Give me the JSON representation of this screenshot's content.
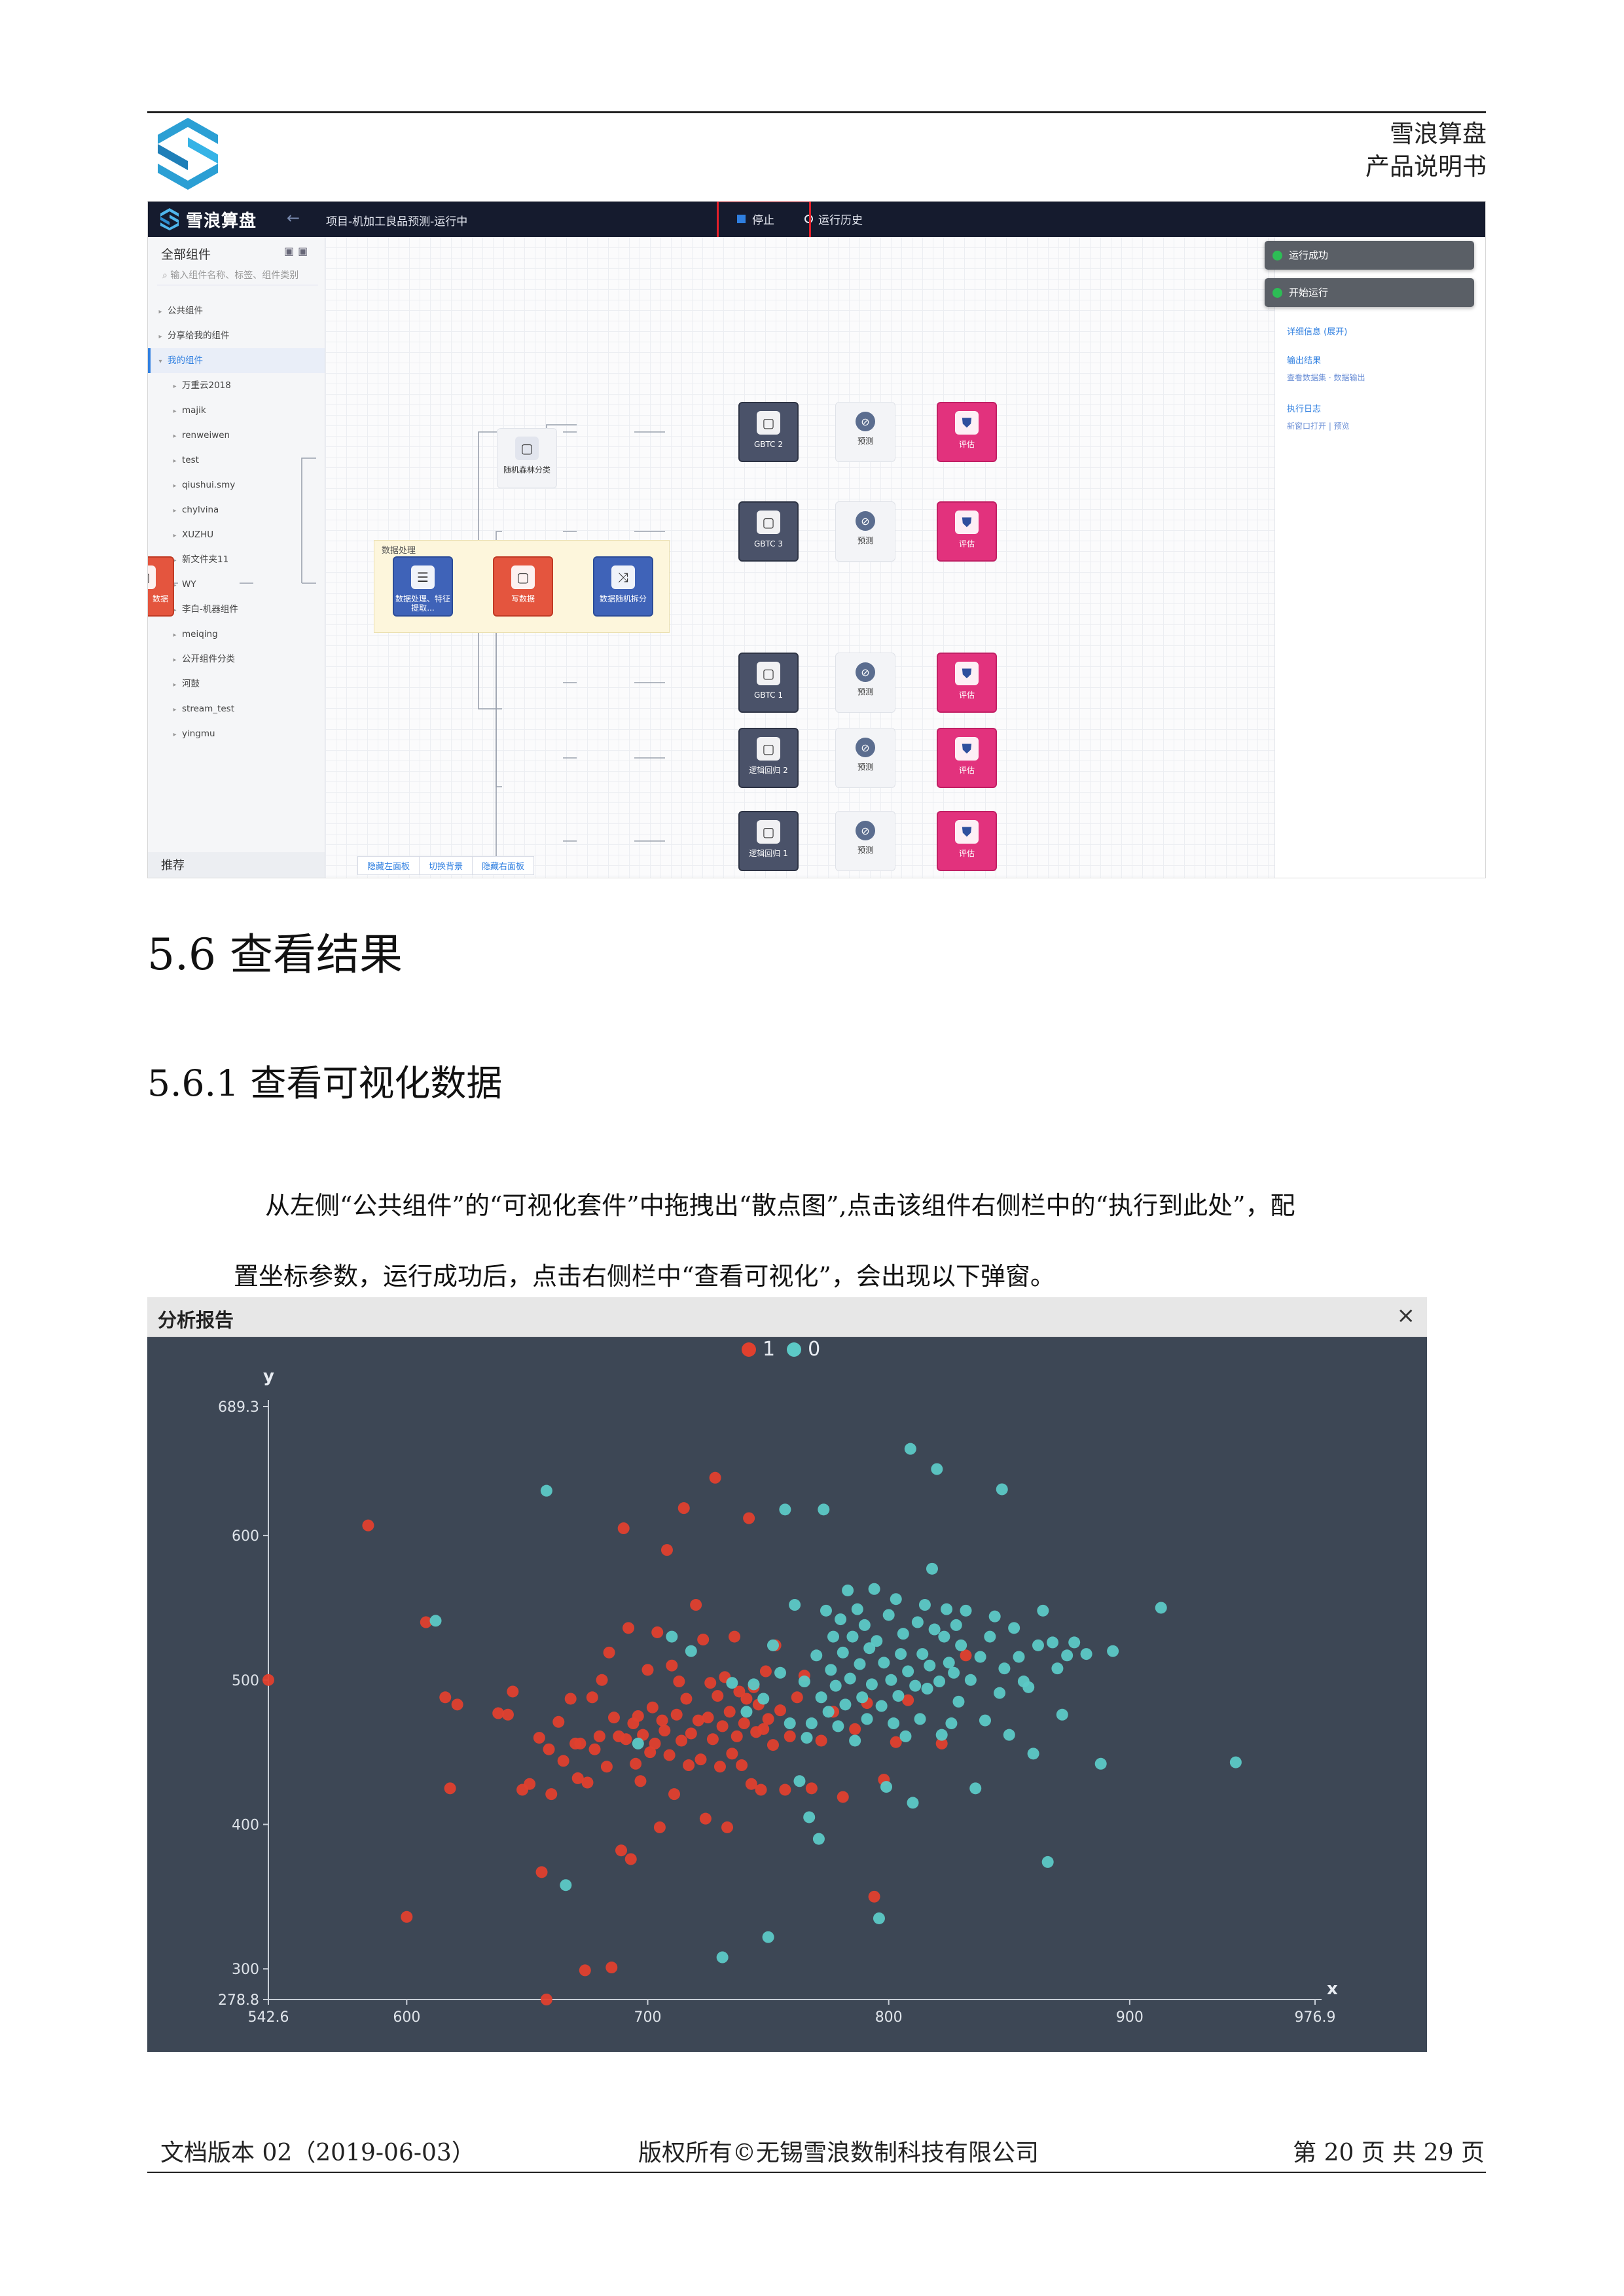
{
  "header": {
    "company_line": "雪浪算盘",
    "doc_line": "产品说明书"
  },
  "app": {
    "brand": "雪浪算盘",
    "breadcrumb": "项目-机加工良品预测-运行中",
    "stop_label": "停止",
    "history_label": "运行历史",
    "sidebar": {
      "title": "全部组件",
      "search_placeholder": "输入组件名称、标签、组件类别",
      "items": [
        {
          "label": "公共组件",
          "level": 0
        },
        {
          "label": "分享给我的组件",
          "level": 0
        },
        {
          "label": "我的组件",
          "level": 0,
          "active": true
        },
        {
          "label": "万重云2018",
          "level": 1
        },
        {
          "label": "majik",
          "level": 1
        },
        {
          "label": "renweiwen",
          "level": 1
        },
        {
          "label": "test",
          "level": 1
        },
        {
          "label": "qiushui.smy",
          "level": 1
        },
        {
          "label": "chylvina",
          "level": 1
        },
        {
          "label": "XUZHU",
          "level": 1
        },
        {
          "label": "新文件夹11",
          "level": 1
        },
        {
          "label": "WY",
          "level": 1
        },
        {
          "label": "李白-机器组件",
          "level": 1
        },
        {
          "label": "meiqing",
          "level": 1
        },
        {
          "label": "公开组件分类",
          "level": 1
        },
        {
          "label": "河鼓",
          "level": 1
        },
        {
          "label": "stream_test",
          "level": 1
        },
        {
          "label": "yingmu",
          "level": 1
        }
      ],
      "footer": "推荐"
    },
    "bottom_tabs": [
      "隐藏左面板",
      "切换背景",
      "隐藏右面板"
    ],
    "group_label": "数据处理",
    "nodes": {
      "source": "数据",
      "process": "数据处理、特征提取...",
      "write": "写数据",
      "split": "数据随机拆分",
      "rf": "随机森林分类",
      "models": [
        "GBTC 2",
        "GBTC 3",
        "GBTC 1",
        "逻辑回归 2",
        "逻辑回归 1"
      ],
      "predict": "预测",
      "eval": "评估"
    },
    "toasts": [
      "运行成功",
      "开始运行"
    ],
    "right_panel": {
      "detail": "详细信息 (展开)",
      "output_title": "输出结果",
      "output_link": "查看数据集 · 数据输出",
      "log_title": "执行日志",
      "log_link": "新窗口打开 | 预览"
    }
  },
  "section": {
    "h2": "5.6 查看结果",
    "h3": "5.6.1 查看可视化数据"
  },
  "paragraph": {
    "line1": "从左侧“公共组件”的“可视化套件”中拖拽出“散点图”,点击该组件右侧栏中的“执行到此处”，配",
    "line2": "置坐标参数，运行成功后，点击右侧栏中“查看可视化”，会出现以下弹窗。"
  },
  "report": {
    "title": "分析报告",
    "close": "×"
  },
  "chart_data": {
    "type": "scatter",
    "title": "",
    "xlabel": "x",
    "ylabel": "y",
    "xlim": [
      542.6,
      976.9
    ],
    "ylim": [
      278.8,
      689.3
    ],
    "x_ticks": [
      "542.6",
      "600",
      "700",
      "800",
      "900",
      "976.9"
    ],
    "y_ticks": [
      "278.8",
      "300",
      "400",
      "500",
      "600",
      "689.3"
    ],
    "legend": {
      "position": "top-center"
    },
    "colors": {
      "1": "#e0402e",
      "0": "#5cc9c6",
      "background": "#3d4755",
      "axis": "#c9cfd8"
    },
    "series": [
      {
        "name": "1",
        "color": "#e0402e",
        "points": [
          [
            542.6,
            500
          ],
          [
            584,
            607
          ],
          [
            600,
            336
          ],
          [
            608,
            540
          ],
          [
            616,
            488
          ],
          [
            618,
            425
          ],
          [
            621,
            483
          ],
          [
            638,
            477
          ],
          [
            642,
            476
          ],
          [
            644,
            492
          ],
          [
            648,
            424
          ],
          [
            651,
            428
          ],
          [
            655,
            460
          ],
          [
            656,
            367
          ],
          [
            658,
            278.8
          ],
          [
            659,
            452
          ],
          [
            660,
            421
          ],
          [
            663,
            471
          ],
          [
            665,
            444
          ],
          [
            668,
            487
          ],
          [
            670,
            456
          ],
          [
            671,
            432
          ],
          [
            672,
            456
          ],
          [
            674,
            299
          ],
          [
            675,
            429
          ],
          [
            677,
            488
          ],
          [
            678,
            452
          ],
          [
            680,
            461
          ],
          [
            681,
            500
          ],
          [
            683,
            440
          ],
          [
            684,
            519
          ],
          [
            685,
            301
          ],
          [
            686,
            474
          ],
          [
            688,
            461
          ],
          [
            689,
            382
          ],
          [
            690,
            605
          ],
          [
            691,
            459
          ],
          [
            692,
            536
          ],
          [
            693,
            376
          ],
          [
            694,
            470
          ],
          [
            695,
            442
          ],
          [
            696,
            475
          ],
          [
            697,
            430
          ],
          [
            698,
            462
          ],
          [
            700,
            507
          ],
          [
            701,
            450
          ],
          [
            702,
            481
          ],
          [
            703,
            456
          ],
          [
            704,
            533
          ],
          [
            705,
            398
          ],
          [
            706,
            472
          ],
          [
            707,
            465
          ],
          [
            708,
            590
          ],
          [
            709,
            448
          ],
          [
            710,
            510
          ],
          [
            711,
            421
          ],
          [
            712,
            476
          ],
          [
            713,
            499
          ],
          [
            714,
            458
          ],
          [
            715,
            619
          ],
          [
            716,
            487
          ],
          [
            717,
            441
          ],
          [
            718,
            463
          ],
          [
            720,
            552
          ],
          [
            721,
            472
          ],
          [
            722,
            445
          ],
          [
            723,
            528
          ],
          [
            724,
            404
          ],
          [
            725,
            474
          ],
          [
            726,
            498
          ],
          [
            727,
            459
          ],
          [
            728,
            640
          ],
          [
            729,
            489
          ],
          [
            730,
            440
          ],
          [
            731,
            468
          ],
          [
            732,
            502
          ],
          [
            733,
            398
          ],
          [
            734,
            478
          ],
          [
            735,
            449
          ],
          [
            736,
            530
          ],
          [
            737,
            461
          ],
          [
            738,
            492
          ],
          [
            739,
            441
          ],
          [
            740,
            470
          ],
          [
            741,
            487
          ],
          [
            742,
            612
          ],
          [
            743,
            428
          ],
          [
            744,
            495
          ],
          [
            745,
            464
          ],
          [
            746,
            483
          ],
          [
            747,
            424
          ],
          [
            748,
            466
          ],
          [
            749,
            506
          ],
          [
            750,
            473
          ],
          [
            752,
            455
          ],
          [
            753,
            524
          ],
          [
            755,
            479
          ],
          [
            757,
            424
          ],
          [
            759,
            461
          ],
          [
            762,
            488
          ],
          [
            765,
            503
          ],
          [
            768,
            425
          ],
          [
            772,
            458
          ],
          [
            777,
            478
          ],
          [
            781,
            419
          ],
          [
            786,
            466
          ],
          [
            791,
            484
          ],
          [
            794,
            350
          ],
          [
            798,
            431
          ],
          [
            803,
            457
          ],
          [
            808,
            486
          ],
          [
            822,
            456
          ],
          [
            832,
            517
          ]
        ]
      },
      {
        "name": "0",
        "color": "#5cc9c6",
        "points": [
          [
            612,
            541
          ],
          [
            658,
            631
          ],
          [
            666,
            358
          ],
          [
            696,
            456
          ],
          [
            710,
            530
          ],
          [
            718,
            520
          ],
          [
            731,
            308
          ],
          [
            735,
            498
          ],
          [
            741,
            478
          ],
          [
            744,
            497
          ],
          [
            748,
            487
          ],
          [
            750,
            322
          ],
          [
            752,
            524
          ],
          [
            755,
            505
          ],
          [
            757,
            618
          ],
          [
            759,
            470
          ],
          [
            761,
            552
          ],
          [
            763,
            430
          ],
          [
            765,
            499
          ],
          [
            766,
            460
          ],
          [
            767,
            405
          ],
          [
            768,
            470
          ],
          [
            770,
            517
          ],
          [
            771,
            390
          ],
          [
            772,
            488
          ],
          [
            773,
            618
          ],
          [
            774,
            548
          ],
          [
            775,
            478
          ],
          [
            776,
            507
          ],
          [
            777,
            530
          ],
          [
            778,
            496
          ],
          [
            779,
            468
          ],
          [
            780,
            542
          ],
          [
            781,
            519
          ],
          [
            782,
            483
          ],
          [
            783,
            562
          ],
          [
            784,
            501
          ],
          [
            785,
            530
          ],
          [
            786,
            458
          ],
          [
            787,
            549
          ],
          [
            788,
            511
          ],
          [
            789,
            488
          ],
          [
            790,
            538
          ],
          [
            791,
            473
          ],
          [
            792,
            522
          ],
          [
            793,
            497
          ],
          [
            794,
            563
          ],
          [
            795,
            527
          ],
          [
            796,
            335
          ],
          [
            797,
            482
          ],
          [
            798,
            512
          ],
          [
            799,
            426
          ],
          [
            800,
            545
          ],
          [
            801,
            500
          ],
          [
            802,
            470
          ],
          [
            803,
            556
          ],
          [
            804,
            489
          ],
          [
            805,
            518
          ],
          [
            806,
            532
          ],
          [
            807,
            461
          ],
          [
            808,
            506
          ],
          [
            809,
            660
          ],
          [
            810,
            415
          ],
          [
            811,
            496
          ],
          [
            812,
            540
          ],
          [
            813,
            473
          ],
          [
            814,
            518
          ],
          [
            815,
            552
          ],
          [
            816,
            494
          ],
          [
            817,
            510
          ],
          [
            818,
            577
          ],
          [
            819,
            535
          ],
          [
            820,
            646
          ],
          [
            821,
            499
          ],
          [
            822,
            462
          ],
          [
            823,
            530
          ],
          [
            824,
            549
          ],
          [
            825,
            512
          ],
          [
            826,
            470
          ],
          [
            827,
            505
          ],
          [
            828,
            538
          ],
          [
            829,
            485
          ],
          [
            830,
            524
          ],
          [
            832,
            548
          ],
          [
            834,
            500
          ],
          [
            836,
            425
          ],
          [
            838,
            516
          ],
          [
            840,
            472
          ],
          [
            842,
            530
          ],
          [
            844,
            544
          ],
          [
            846,
            491
          ],
          [
            847,
            632
          ],
          [
            848,
            508
          ],
          [
            850,
            462
          ],
          [
            852,
            536
          ],
          [
            854,
            516
          ],
          [
            856,
            499
          ],
          [
            858,
            495
          ],
          [
            860,
            449
          ],
          [
            862,
            524
          ],
          [
            864,
            548
          ],
          [
            866,
            374
          ],
          [
            868,
            526
          ],
          [
            870,
            508
          ],
          [
            872,
            476
          ],
          [
            874,
            517
          ],
          [
            877,
            526
          ],
          [
            882,
            518
          ],
          [
            888,
            442
          ],
          [
            893,
            520
          ],
          [
            913,
            550
          ],
          [
            944,
            443
          ]
        ]
      }
    ]
  }
}
